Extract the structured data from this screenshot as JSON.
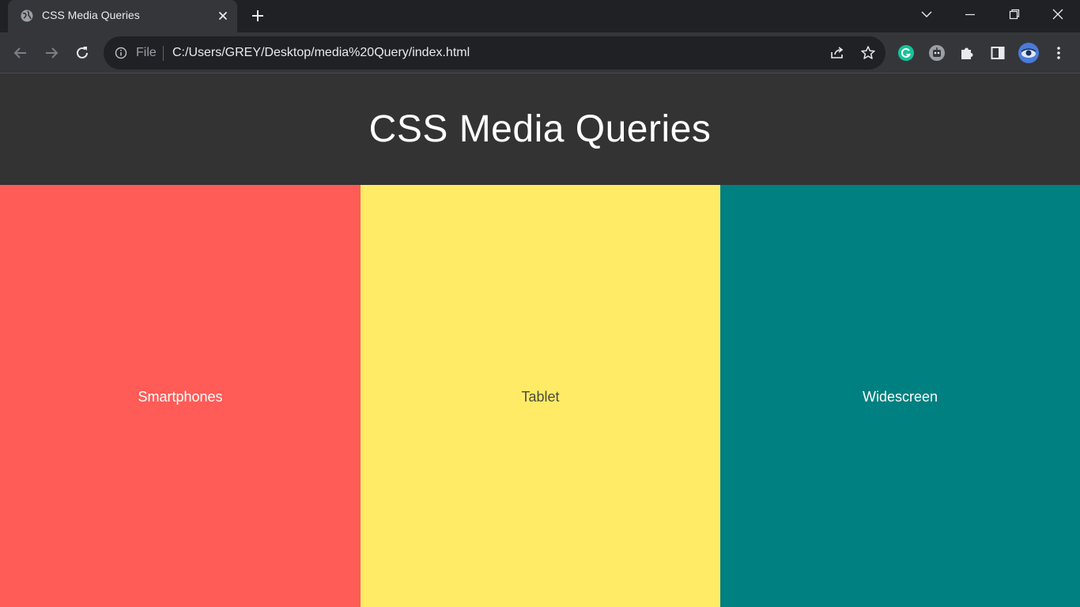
{
  "browser": {
    "tab": {
      "title": "CSS Media Queries",
      "favicon": "globe-icon"
    },
    "controls": {
      "tab_search": "chevron-down-icon",
      "minimize": "minimize-icon",
      "restore": "restore-icon",
      "close": "close-icon"
    },
    "toolbar": {
      "back": "back-arrow-icon",
      "forward": "forward-arrow-icon",
      "reload": "reload-icon",
      "site_label": "File",
      "url": "C:/Users/GREY/Desktop/media%20Query/index.html",
      "extensions": [
        "grammarly-icon",
        "robot-extension-icon",
        "puzzle-icon",
        "side-panel-icon",
        "profile-avatar"
      ],
      "menu": "kebab-menu-icon"
    }
  },
  "page": {
    "title": "CSS Media Queries",
    "panels": [
      {
        "label": "Smartphones",
        "bg": "#ff5b57",
        "fg": "#ffffff"
      },
      {
        "label": "Tablet",
        "bg": "#ffeb66",
        "fg": "#4a4a40"
      },
      {
        "label": "Widescreen",
        "bg": "#008080",
        "fg": "#ffffff"
      }
    ]
  },
  "colors": {
    "header_bg": "#333333",
    "chrome_dark": "#202124",
    "chrome_toolbar": "#35363a"
  }
}
